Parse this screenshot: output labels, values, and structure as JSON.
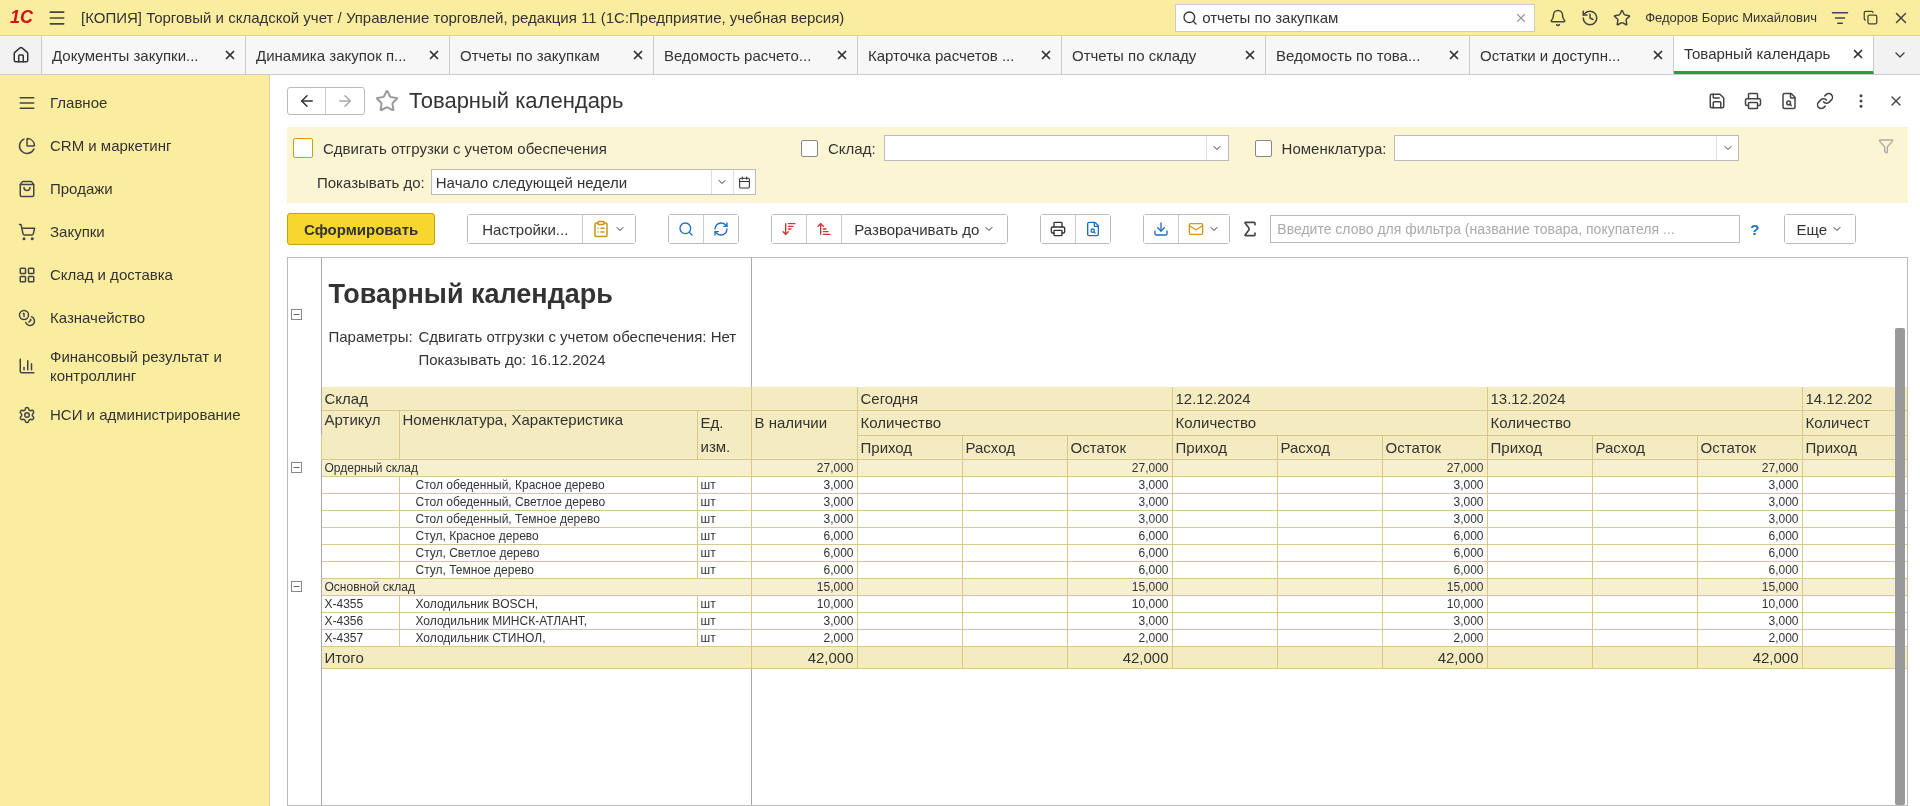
{
  "app": {
    "logo": "1С",
    "title": "[КОПИЯ] Торговый и складской учет / Управление торговлей, редакция 11  (1С:Предприятие, учебная версия)",
    "search": {
      "value": "отчеты по закупкам"
    },
    "user": "Федоров Борис Михайлович"
  },
  "tabs": [
    {
      "label": "Документы закупки...",
      "selected": false
    },
    {
      "label": "Динамика закупок п...",
      "selected": false
    },
    {
      "label": "Отчеты по закупкам",
      "selected": false
    },
    {
      "label": "Ведомость расчето...",
      "selected": false
    },
    {
      "label": "Карточка расчетов ...",
      "selected": false
    },
    {
      "label": "Отчеты по складу",
      "selected": false
    },
    {
      "label": "Ведомость по това...",
      "selected": false
    },
    {
      "label": "Остатки и доступн...",
      "selected": false
    },
    {
      "label": "Товарный календарь",
      "selected": true
    }
  ],
  "sidebar": {
    "items": [
      {
        "label": "Главное",
        "kind": "list"
      },
      {
        "label": "CRM и маркетинг",
        "kind": "pie"
      },
      {
        "label": "Продажи",
        "kind": "bag"
      },
      {
        "label": "Закупки",
        "kind": "cart"
      },
      {
        "label": "Склад и доставка",
        "kind": "grid"
      },
      {
        "label": "Казначейство",
        "kind": "coins"
      },
      {
        "label": "Финансовый результат и контроллинг",
        "kind": "chart"
      },
      {
        "label": "НСИ и администрирование",
        "kind": "gear"
      }
    ]
  },
  "form": {
    "title": "Товарный календарь",
    "filters": {
      "shift": {
        "label": "Сдвигать отгрузки с учетом обеспечения",
        "checked": false
      },
      "warehouse": {
        "label": "Склад:",
        "checked": false
      },
      "nomenclature": {
        "label": "Номенклатура:",
        "checked": false
      },
      "show_until": {
        "label": "Показывать до:",
        "value": "Начало следующей недели"
      }
    },
    "toolbar": {
      "generate": "Сформировать",
      "settings": "Настройки...",
      "expand": "Разворачивать до",
      "filter": {
        "placeholder": "Введите слово для фильтра (название товара, покупателя ..."
      },
      "help": "?",
      "more": "Еще"
    }
  },
  "report": {
    "title": "Товарный календарь",
    "params_label": "Параметры:",
    "params": [
      "Сдвигать отгрузки с учетом обеспечения: Нет",
      "Показывать до: 16.12.2024"
    ],
    "columns": {
      "warehouse": "Склад",
      "article": "Артикул",
      "name": "Номенклатура, Характеристика",
      "unit": "Ед. изм.",
      "available": "В наличии"
    },
    "periods": [
      {
        "label": "Сегодня",
        "measure": "Количество",
        "subcolumns": [
          "Приход",
          "Расход",
          "Остаток"
        ]
      },
      {
        "label": "12.12.2024",
        "measure": "Количество",
        "subcolumns": [
          "Приход",
          "Расход",
          "Остаток"
        ]
      },
      {
        "label": "13.12.2024",
        "measure": "Количество",
        "subcolumns": [
          "Приход",
          "Расход",
          "Остаток"
        ]
      },
      {
        "label": "14.12.202",
        "measure": "Количест",
        "subcolumns": [
          "Приход"
        ]
      }
    ],
    "groups": [
      {
        "name": "Ордерный склад",
        "expanded": true,
        "available": "27,000",
        "balances": [
          "27,000",
          "27,000",
          "27,000"
        ],
        "rows": [
          {
            "name": "Стол обеденный, Красное дерево",
            "unit": "шт",
            "available": "3,000",
            "balances": [
              "3,000",
              "3,000",
              "3,000"
            ]
          },
          {
            "name": "Стол обеденный, Светлое дерево",
            "unit": "шт",
            "available": "3,000",
            "balances": [
              "3,000",
              "3,000",
              "3,000"
            ]
          },
          {
            "name": "Стол обеденный, Темное дерево",
            "unit": "шт",
            "available": "3,000",
            "balances": [
              "3,000",
              "3,000",
              "3,000"
            ]
          },
          {
            "name": "Стул, Красное дерево",
            "unit": "шт",
            "available": "6,000",
            "balances": [
              "6,000",
              "6,000",
              "6,000"
            ]
          },
          {
            "name": "Стул, Светлое дерево",
            "unit": "шт",
            "available": "6,000",
            "balances": [
              "6,000",
              "6,000",
              "6,000"
            ]
          },
          {
            "name": "Стул, Темное дерево",
            "unit": "шт",
            "available": "6,000",
            "balances": [
              "6,000",
              "6,000",
              "6,000"
            ]
          }
        ]
      },
      {
        "name": "Основной склад",
        "expanded": true,
        "available": "15,000",
        "balances": [
          "15,000",
          "15,000",
          "15,000"
        ],
        "rows": [
          {
            "article": "Х-4355",
            "name": "Холодильник BOSCH,",
            "unit": "шт",
            "available": "10,000",
            "balances": [
              "10,000",
              "10,000",
              "10,000"
            ]
          },
          {
            "article": "Х-4356",
            "name": "Холодильник МИНСК-АТЛАНТ,",
            "unit": "шт",
            "available": "3,000",
            "balances": [
              "3,000",
              "3,000",
              "3,000"
            ]
          },
          {
            "article": "Х-4357",
            "name": "Холодильник СТИНОЛ,",
            "unit": "шт",
            "available": "2,000",
            "balances": [
              "2,000",
              "2,000",
              "2,000"
            ]
          }
        ]
      }
    ],
    "total": {
      "label": "Итого",
      "available": "42,000",
      "balances": [
        "42,000",
        "42,000",
        "42,000"
      ]
    }
  }
}
